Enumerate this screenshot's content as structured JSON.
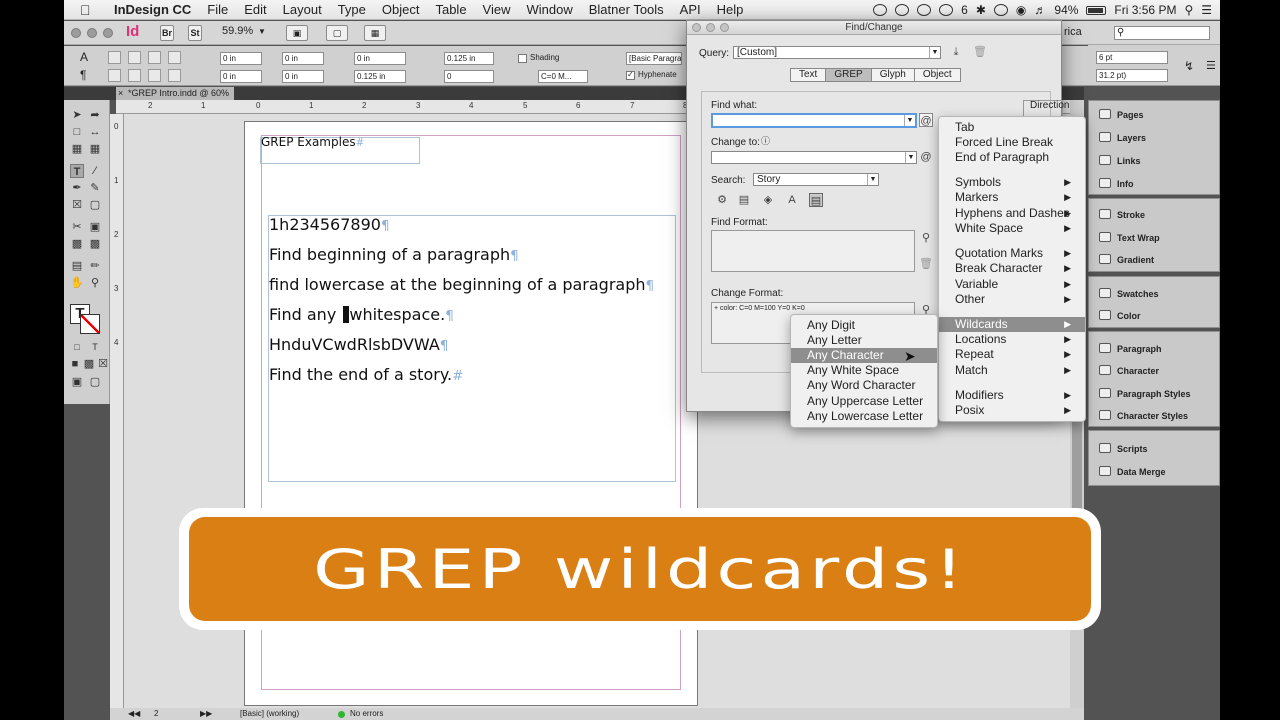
{
  "menubar": {
    "app": "InDesign CC",
    "items": [
      "File",
      "Edit",
      "Layout",
      "Type",
      "Object",
      "Table",
      "View",
      "Window",
      "Blatner Tools",
      "API",
      "Help"
    ],
    "cc_count": "6",
    "battery": "94%",
    "clock": "Fri 3:56 PM"
  },
  "appbar": {
    "logo": "Id",
    "bridge": "Br",
    "stock": "St",
    "zoom": "59.9%",
    "workspace_fragment": "rica"
  },
  "control": {
    "indent_left": "0 in",
    "indent_first": "0 in",
    "indent_right": "0 in",
    "indent_last": "0 in",
    "space_before": "0 in",
    "space_after": "0.125 in",
    "dropcap_lines": "0",
    "dropcap_chars": "0",
    "shading_label": "Shading",
    "shading_color": "C=0 M...",
    "hyphenate_label": "Hyphenate",
    "style": "[Basic Paragraph]",
    "pt1": "6 pt",
    "pt2": "31.2 pt)"
  },
  "document": {
    "tab_title": "*GREP Intro.indd @ 60%",
    "ruler_h": [
      "2",
      "1",
      "0",
      "1",
      "2",
      "3",
      "4",
      "5",
      "6",
      "7",
      "8"
    ],
    "ruler_v": [
      "0",
      "1",
      "2",
      "3",
      "4"
    ],
    "title_text": "GREP Examples",
    "lines": [
      {
        "before": "1h234567890",
        "after": ""
      },
      {
        "before": "Find beginning of a paragraph",
        "after": ""
      },
      {
        "before": "find lowercase at the beginning of a paragraph",
        "after": ""
      },
      {
        "before": "Find any ",
        "after": "whitespace."
      },
      {
        "before": "HnduVCwdRlsbDVWA",
        "after": ""
      },
      {
        "before": "Find the end of a story.",
        "after": ""
      }
    ],
    "pilcrow": "¶",
    "story_end": "#",
    "status_page": "2",
    "status_style": "[Basic] (working)",
    "status_errors": "No errors"
  },
  "panels": {
    "group1": [
      "Pages",
      "Layers",
      "Links",
      "Info"
    ],
    "group2": [
      "Stroke",
      "Text Wrap",
      "Gradient"
    ],
    "group3": [
      "Swatches",
      "Color"
    ],
    "group4": [
      "Paragraph",
      "Character",
      "Paragraph Styles",
      "Character Styles"
    ],
    "group5": [
      "Scripts",
      "Data Merge"
    ]
  },
  "dialog": {
    "title": "Find/Change",
    "query_label": "Query:",
    "query_value": "[Custom]",
    "tabs": [
      "Text",
      "GREP",
      "Glyph",
      "Object"
    ],
    "active_tab": "GREP",
    "find_what_label": "Find what:",
    "find_what_value": "",
    "change_to_label": "Change to:",
    "change_to_value": "",
    "search_label": "Search:",
    "search_value": "Story",
    "find_format_label": "Find Format:",
    "change_format_label": "Change Format:",
    "change_format_value": "+ color: C=0 M=100 Y=0 K=0",
    "direction_label": "Direction"
  },
  "special_menu": {
    "items": [
      {
        "label": "Tab",
        "sub": false
      },
      {
        "label": "Forced Line Break",
        "sub": false
      },
      {
        "label": "End of Paragraph",
        "sub": false
      },
      {
        "label": "Symbols",
        "sub": true
      },
      {
        "label": "Markers",
        "sub": true
      },
      {
        "label": "Hyphens and Dashes",
        "sub": true
      },
      {
        "label": "White Space",
        "sub": true
      },
      {
        "label": "Quotation Marks",
        "sub": true
      },
      {
        "label": "Break Character",
        "sub": true
      },
      {
        "label": "Variable",
        "sub": true
      },
      {
        "label": "Other",
        "sub": true
      },
      {
        "label": "Wildcards",
        "sub": true
      },
      {
        "label": "Locations",
        "sub": true
      },
      {
        "label": "Repeat",
        "sub": true
      },
      {
        "label": "Match",
        "sub": true
      },
      {
        "label": "Modifiers",
        "sub": true
      },
      {
        "label": "Posix",
        "sub": true
      }
    ],
    "selected": "Wildcards"
  },
  "wildcards_menu": {
    "items": [
      "Any Digit",
      "Any Letter",
      "Any Character",
      "Any White Space",
      "Any Word Character",
      "Any Uppercase Letter",
      "Any Lowercase Letter"
    ],
    "selected": "Any Character"
  },
  "banner": {
    "text": "GREP wildcards!",
    "color": "#d97f14"
  }
}
